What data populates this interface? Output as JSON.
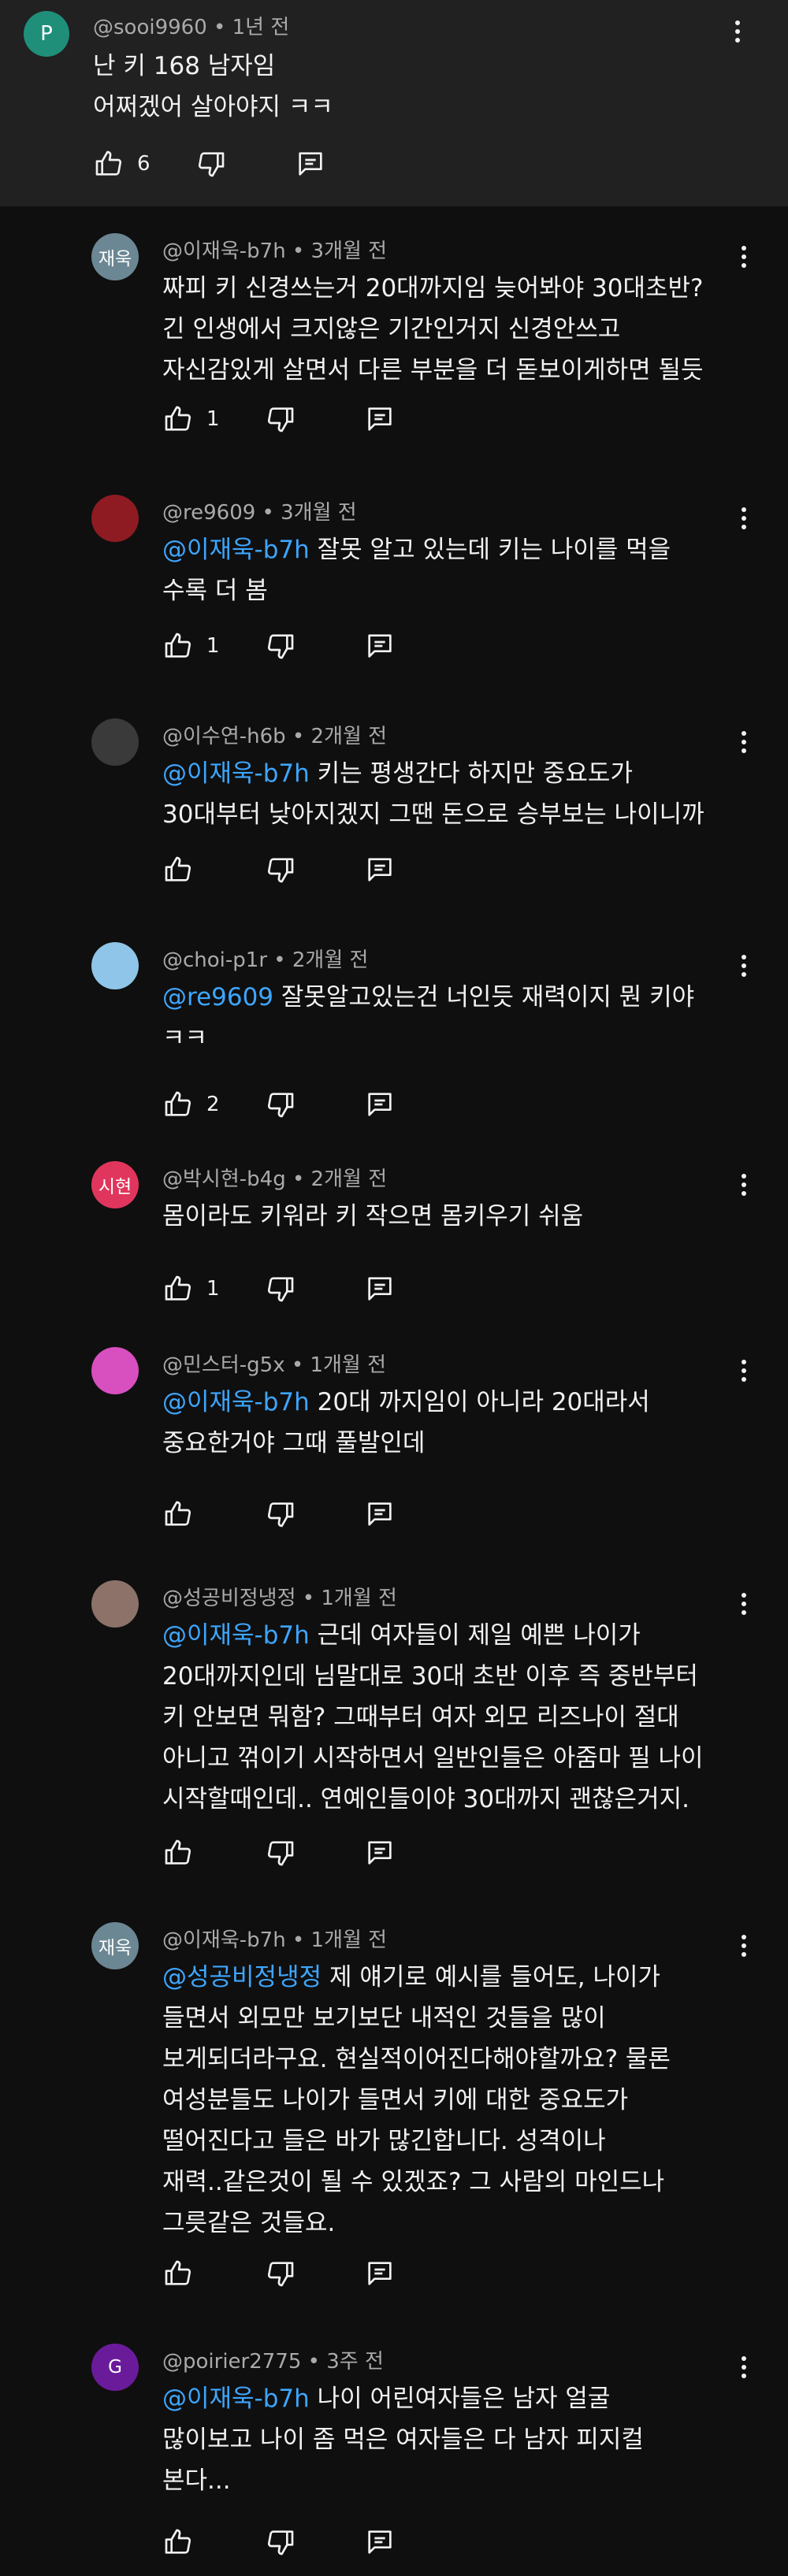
{
  "parent": {
    "avatar_letter": "P",
    "avatar_color": "#1f8f7a",
    "meta": "@sooi9960 • 1년 전",
    "lines": [
      "난 키 168 남자임",
      "어쩌겠어 살아야지 ㅋㅋ"
    ],
    "likes": "6"
  },
  "replies": [
    {
      "avatar_text": "재욱",
      "avatar_color": "#6b8793",
      "meta": "@이재욱-b7h • 3개월 전",
      "mention": "",
      "lines": [
        "짜피 키 신경쓰는거 20대까지임 늦어봐야 30대초반?",
        "긴 인생에서 크지않은 기간인거지 신경안쓰고",
        "자신감있게 살면서 다른 부분을 더 돋보이게하면 될듯"
      ],
      "likes": "1"
    },
    {
      "avatar_text": "",
      "avatar_color": "#8e1b22",
      "meta": "@re9609 • 3개월 전",
      "mention": "@이재욱-b7h",
      "lines": [
        " 잘못 알고 있는데 키는 나이를 먹을",
        "수록 더 봄"
      ],
      "likes": "1"
    },
    {
      "avatar_text": "",
      "avatar_color": "#3a3a3a",
      "meta": "@이수연-h6b • 2개월 전",
      "mention": "@이재욱-b7h",
      "lines": [
        " 키는 평생간다 하지만 중요도가",
        "30대부터 낮아지겠지 그땐 돈으로 승부보는 나이니까"
      ],
      "likes": ""
    },
    {
      "avatar_text": "",
      "avatar_color": "#8ec5e8",
      "meta": "@choi-p1r • 2개월 전",
      "mention": "@re9609",
      "lines": [
        " 잘못알고있는건 너인듯 재력이지 뭔 키야",
        "ㅋㅋ"
      ],
      "likes": "2"
    },
    {
      "avatar_text": "시현",
      "avatar_color": "#e0365d",
      "meta": "@박시현-b4g • 2개월 전",
      "mention": "",
      "lines": [
        "몸이라도 키워라 키 작으면 몸키우기 쉬움"
      ],
      "likes": "1"
    },
    {
      "avatar_text": "",
      "avatar_color": "#d84fbf",
      "meta": "@민스터-g5x • 1개월 전",
      "mention": "@이재욱-b7h",
      "lines": [
        "  20대 까지임이 아니라 20대라서",
        "중요한거야 그때 풀발인데"
      ],
      "likes": ""
    },
    {
      "avatar_text": "",
      "avatar_color": "#8c7268",
      "meta": "@성공비정냉정 • 1개월 전",
      "mention": "@이재욱-b7h",
      "lines": [
        "  근데 여자들이 제일 예쁜 나이가",
        "20대까지인데 님말대로 30대 초반 이후 즉 중반부터",
        "키 안보면 뭐함? 그때부터 여자 외모 리즈나이 절대",
        "아니고 꺾이기 시작하면서 일반인들은 아줌마 필 나이",
        "시작할때인데.. 연예인들이야 30대까지 괜찮은거지."
      ],
      "likes": ""
    },
    {
      "avatar_text": "재욱",
      "avatar_color": "#6b8793",
      "meta": "@이재욱-b7h • 1개월 전",
      "mention": "@성공비정냉정",
      "lines": [
        "  제 얘기로 예시를 들어도, 나이가",
        "들면서 외모만 보기보단 내적인 것들을 많이",
        "보게되더라구요. 현실적이어진다해야할까요? 물론",
        "여성분들도 나이가 들면서 키에 대한 중요도가",
        "떨어진다고 들은 바가 많긴합니다. 성격이나",
        "재력..같은것이 될 수 있겠죠? 그 사람의 마인드나",
        "그릇같은 것들요."
      ],
      "likes": ""
    },
    {
      "avatar_text": "G",
      "avatar_color": "#6a1b9a",
      "meta": "@poirier2775 • 3주 전",
      "mention": "@이재욱-b7h",
      "lines": [
        " 나이 어린여자들은 남자 얼굴",
        "많이보고 나이 좀 먹은 여자들은 다 남자 피지컬",
        "본다..."
      ],
      "likes": ""
    }
  ],
  "icons": {
    "like": "thumbs-up-icon",
    "dislike": "thumbs-down-icon",
    "reply": "reply-comment-icon",
    "more": "more-vert-icon"
  }
}
